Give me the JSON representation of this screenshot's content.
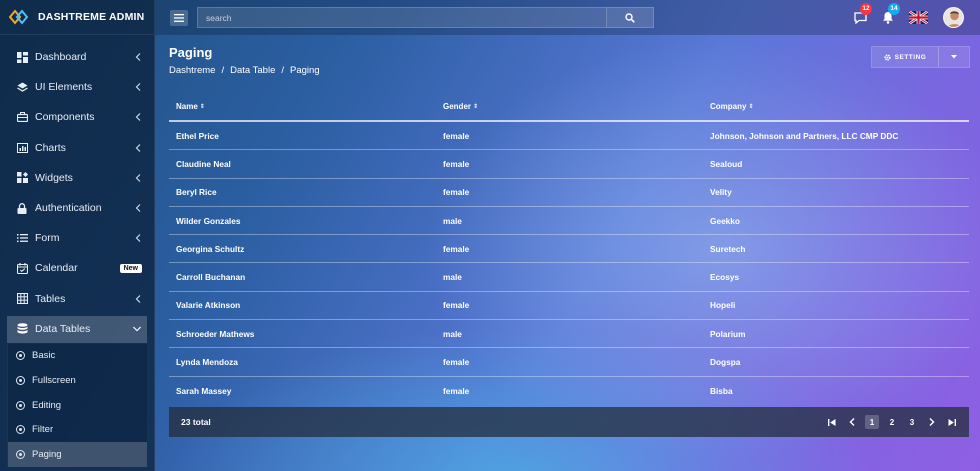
{
  "brand": {
    "name": "DASHTREME ADMIN"
  },
  "search": {
    "placeholder": "search"
  },
  "notifications": {
    "messages_count": "12",
    "alerts_count": "14"
  },
  "sidebar": {
    "items": [
      {
        "label": "Dashboard"
      },
      {
        "label": "UI Elements"
      },
      {
        "label": "Components"
      },
      {
        "label": "Charts"
      },
      {
        "label": "Widgets"
      },
      {
        "label": "Authentication"
      },
      {
        "label": "Form"
      },
      {
        "label": "Calendar",
        "badge": "New"
      },
      {
        "label": "Tables"
      },
      {
        "label": "Data Tables"
      }
    ],
    "submenu": [
      {
        "label": "Basic"
      },
      {
        "label": "Fullscreen"
      },
      {
        "label": "Editing"
      },
      {
        "label": "Filter"
      },
      {
        "label": "Paging"
      }
    ]
  },
  "page": {
    "title": "Paging",
    "breadcrumb": [
      "Dashtreme",
      "Data Table",
      "Paging"
    ],
    "separator": "/",
    "settings_label": "SETTING"
  },
  "table": {
    "headers": [
      "Name",
      "Gender",
      "Company"
    ],
    "rows": [
      [
        "Ethel Price",
        "female",
        "Johnson, Johnson and Partners, LLC CMP DDC"
      ],
      [
        "Claudine Neal",
        "female",
        "Sealoud"
      ],
      [
        "Beryl Rice",
        "female",
        "Velity"
      ],
      [
        "Wilder Gonzales",
        "male",
        "Geekko"
      ],
      [
        "Georgina Schultz",
        "female",
        "Suretech"
      ],
      [
        "Carroll Buchanan",
        "male",
        "Ecosys"
      ],
      [
        "Valarie Atkinson",
        "female",
        "Hopeli"
      ],
      [
        "Schroeder Mathews",
        "male",
        "Polarium"
      ],
      [
        "Lynda Mendoza",
        "female",
        "Dogspa"
      ],
      [
        "Sarah Massey",
        "female",
        "Bisba"
      ]
    ],
    "total": "23 total",
    "pages": [
      "1",
      "2",
      "3"
    ],
    "current_page": "1"
  }
}
